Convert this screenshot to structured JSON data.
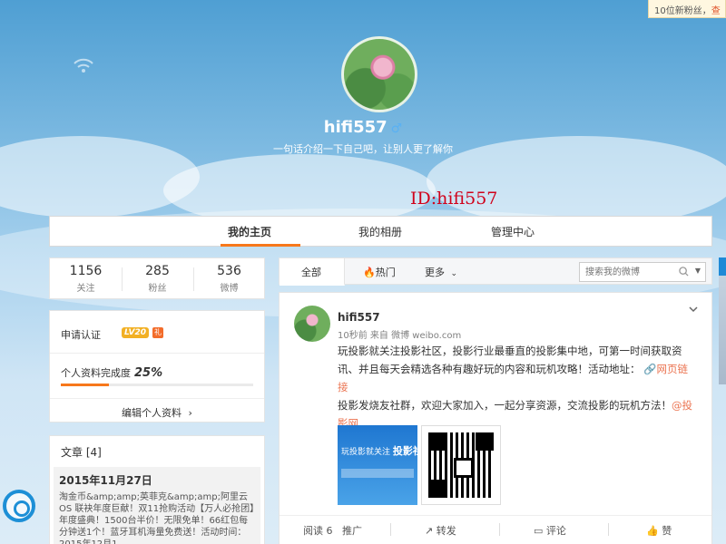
{
  "top_notification": {
    "text": "10位新粉丝，",
    "link": "查"
  },
  "profile_header": {
    "username": "hifi557",
    "gender_symbol": "♂",
    "bio": "一句话介绍一下自己吧，让别人更了解你",
    "id_overlay": "ID:hifi557"
  },
  "nav": {
    "tabs": [
      {
        "label": "我的主页",
        "active": true
      },
      {
        "label": "我的相册",
        "active": false
      },
      {
        "label": "管理中心",
        "active": false
      }
    ],
    "accent_color": "#f7781b"
  },
  "stats": [
    {
      "value": "1156",
      "label": "关注"
    },
    {
      "value": "285",
      "label": "粉丝"
    },
    {
      "value": "536",
      "label": "微博"
    }
  ],
  "profile_card": {
    "verify_label": "申请认证",
    "level_badge": "LV20",
    "completeness_label": "个人资料完成度",
    "completeness_value": "25%",
    "completeness_fraction": 0.25,
    "edit_label": "编辑个人资料",
    "edit_arrow": "›"
  },
  "articles": {
    "header": "文章 [4]",
    "date": "2015年11月27日",
    "text": "淘金币&amp;amp;英菲克&amp;amp;阿里云OS 联袂年度巨献！双11抢购活动【万人必抢团】年度盛典！1500台半价！无限免单！66红包每分钟送1个！蓝牙耳机海量免费送！活动时间：2015年12月1"
  },
  "feed_bar": {
    "tabs": [
      {
        "label": "全部",
        "active": true
      },
      {
        "label": "热门",
        "icon": "fire-icon"
      },
      {
        "label": "更多",
        "icon": "chevron-down-icon"
      }
    ],
    "search_placeholder": "搜索我的微博"
  },
  "post": {
    "author": "hifi557",
    "meta": "10秒前 来自 微博 weibo.com",
    "text_1": "玩投影就关注投影社区，投影行业最垂直的投影集中地，可第一时间获取资讯、并且每天会精选各种有趣好玩的内容和玩机攻略！活动地址：",
    "link_1": "网页链接",
    "text_2": "投影发烧友社群，欢迎大家加入，一起分享资源，交流投影的玩机方法！",
    "link_2": "@投影网",
    "thumb_text": "玩投影就关注",
    "thumb_bold": "投影社区",
    "actions": [
      {
        "label": "阅读 6",
        "icon": null
      },
      {
        "label": "推广",
        "icon": null
      },
      {
        "label": "转发",
        "icon": "repost-icon"
      },
      {
        "label": "评论",
        "icon": "comment-icon"
      },
      {
        "label": "赞",
        "icon": "thumbs-up-icon"
      }
    ]
  }
}
